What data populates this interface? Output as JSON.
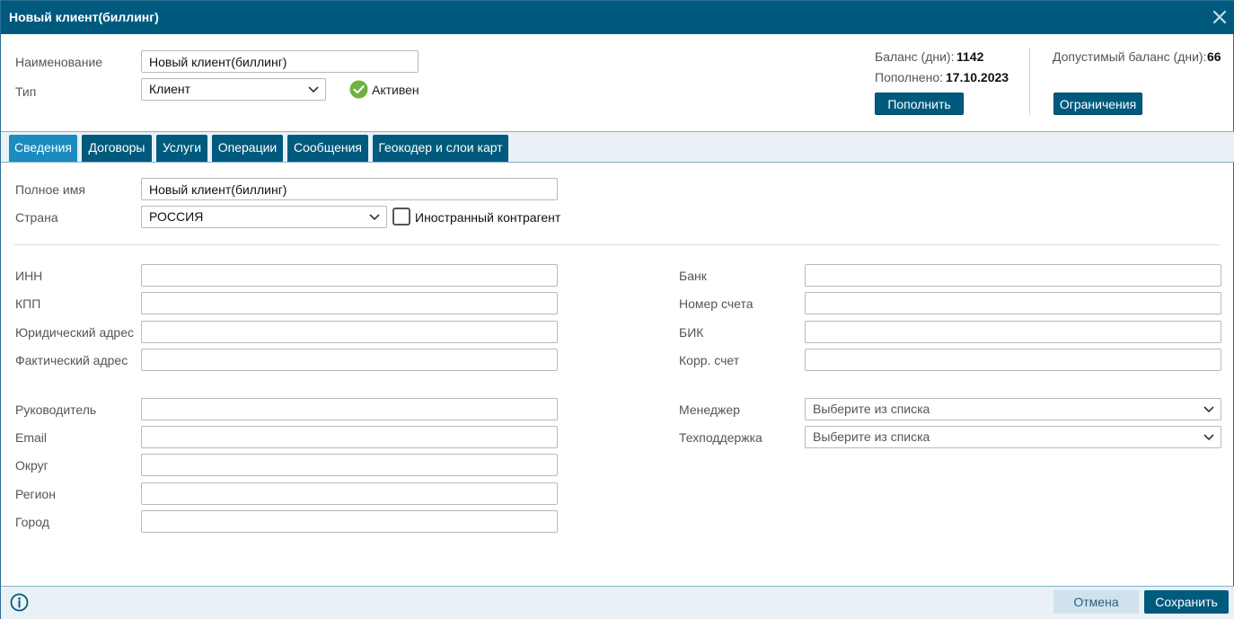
{
  "window": {
    "title": "Новый клиент(биллинг)"
  },
  "header": {
    "name_label": "Наименование",
    "name_value": "Новый клиент(биллинг)",
    "type_label": "Тип",
    "type_value": "Клиент",
    "status_text": "Активен",
    "balance_label": "Баланс (дни):",
    "balance_value": "1142",
    "replenished_label": "Пополнено:",
    "replenished_value": "17.10.2023",
    "allowed_balance_label": "Допустимый баланс (дни):",
    "allowed_balance_value": "66",
    "replenish_button": "Пополнить",
    "limits_button": "Ограничения"
  },
  "tabs": [
    {
      "label": "Сведения"
    },
    {
      "label": "Договоры"
    },
    {
      "label": "Услуги"
    },
    {
      "label": "Операции"
    },
    {
      "label": "Сообщения"
    },
    {
      "label": "Геокодер и слои карт"
    }
  ],
  "info": {
    "full_name_label": "Полное имя",
    "full_name_value": "Новый клиент(биллинг)",
    "country_label": "Страна",
    "country_value": "РОССИЯ",
    "foreign_label": "Иностранный контрагент"
  },
  "left_fields": {
    "inn": {
      "label": "ИНН",
      "value": ""
    },
    "kpp": {
      "label": "КПП",
      "value": ""
    },
    "legal_address": {
      "label": "Юридический адрес",
      "value": ""
    },
    "actual_address": {
      "label": "Фактический адрес",
      "value": ""
    },
    "director": {
      "label": "Руководитель",
      "value": ""
    },
    "email": {
      "label": "Email",
      "value": ""
    },
    "district": {
      "label": "Округ",
      "value": ""
    },
    "region": {
      "label": "Регион",
      "value": ""
    },
    "city": {
      "label": "Город",
      "value": ""
    }
  },
  "right_fields": {
    "bank": {
      "label": "Банк",
      "value": ""
    },
    "account": {
      "label": "Номер счета",
      "value": ""
    },
    "bik": {
      "label": "БИК",
      "value": ""
    },
    "corr_account": {
      "label": "Корр. счет",
      "value": ""
    },
    "manager": {
      "label": "Менеджер",
      "placeholder": "Выберите из списка"
    },
    "support": {
      "label": "Техподдержка",
      "placeholder": "Выберите из списка"
    }
  },
  "footer": {
    "cancel_label": "Отмена",
    "save_label": "Сохранить"
  },
  "colors": {
    "primary": "#005a7d",
    "active_tab": "#1a8cc0",
    "status_green": "#6cb33f"
  }
}
